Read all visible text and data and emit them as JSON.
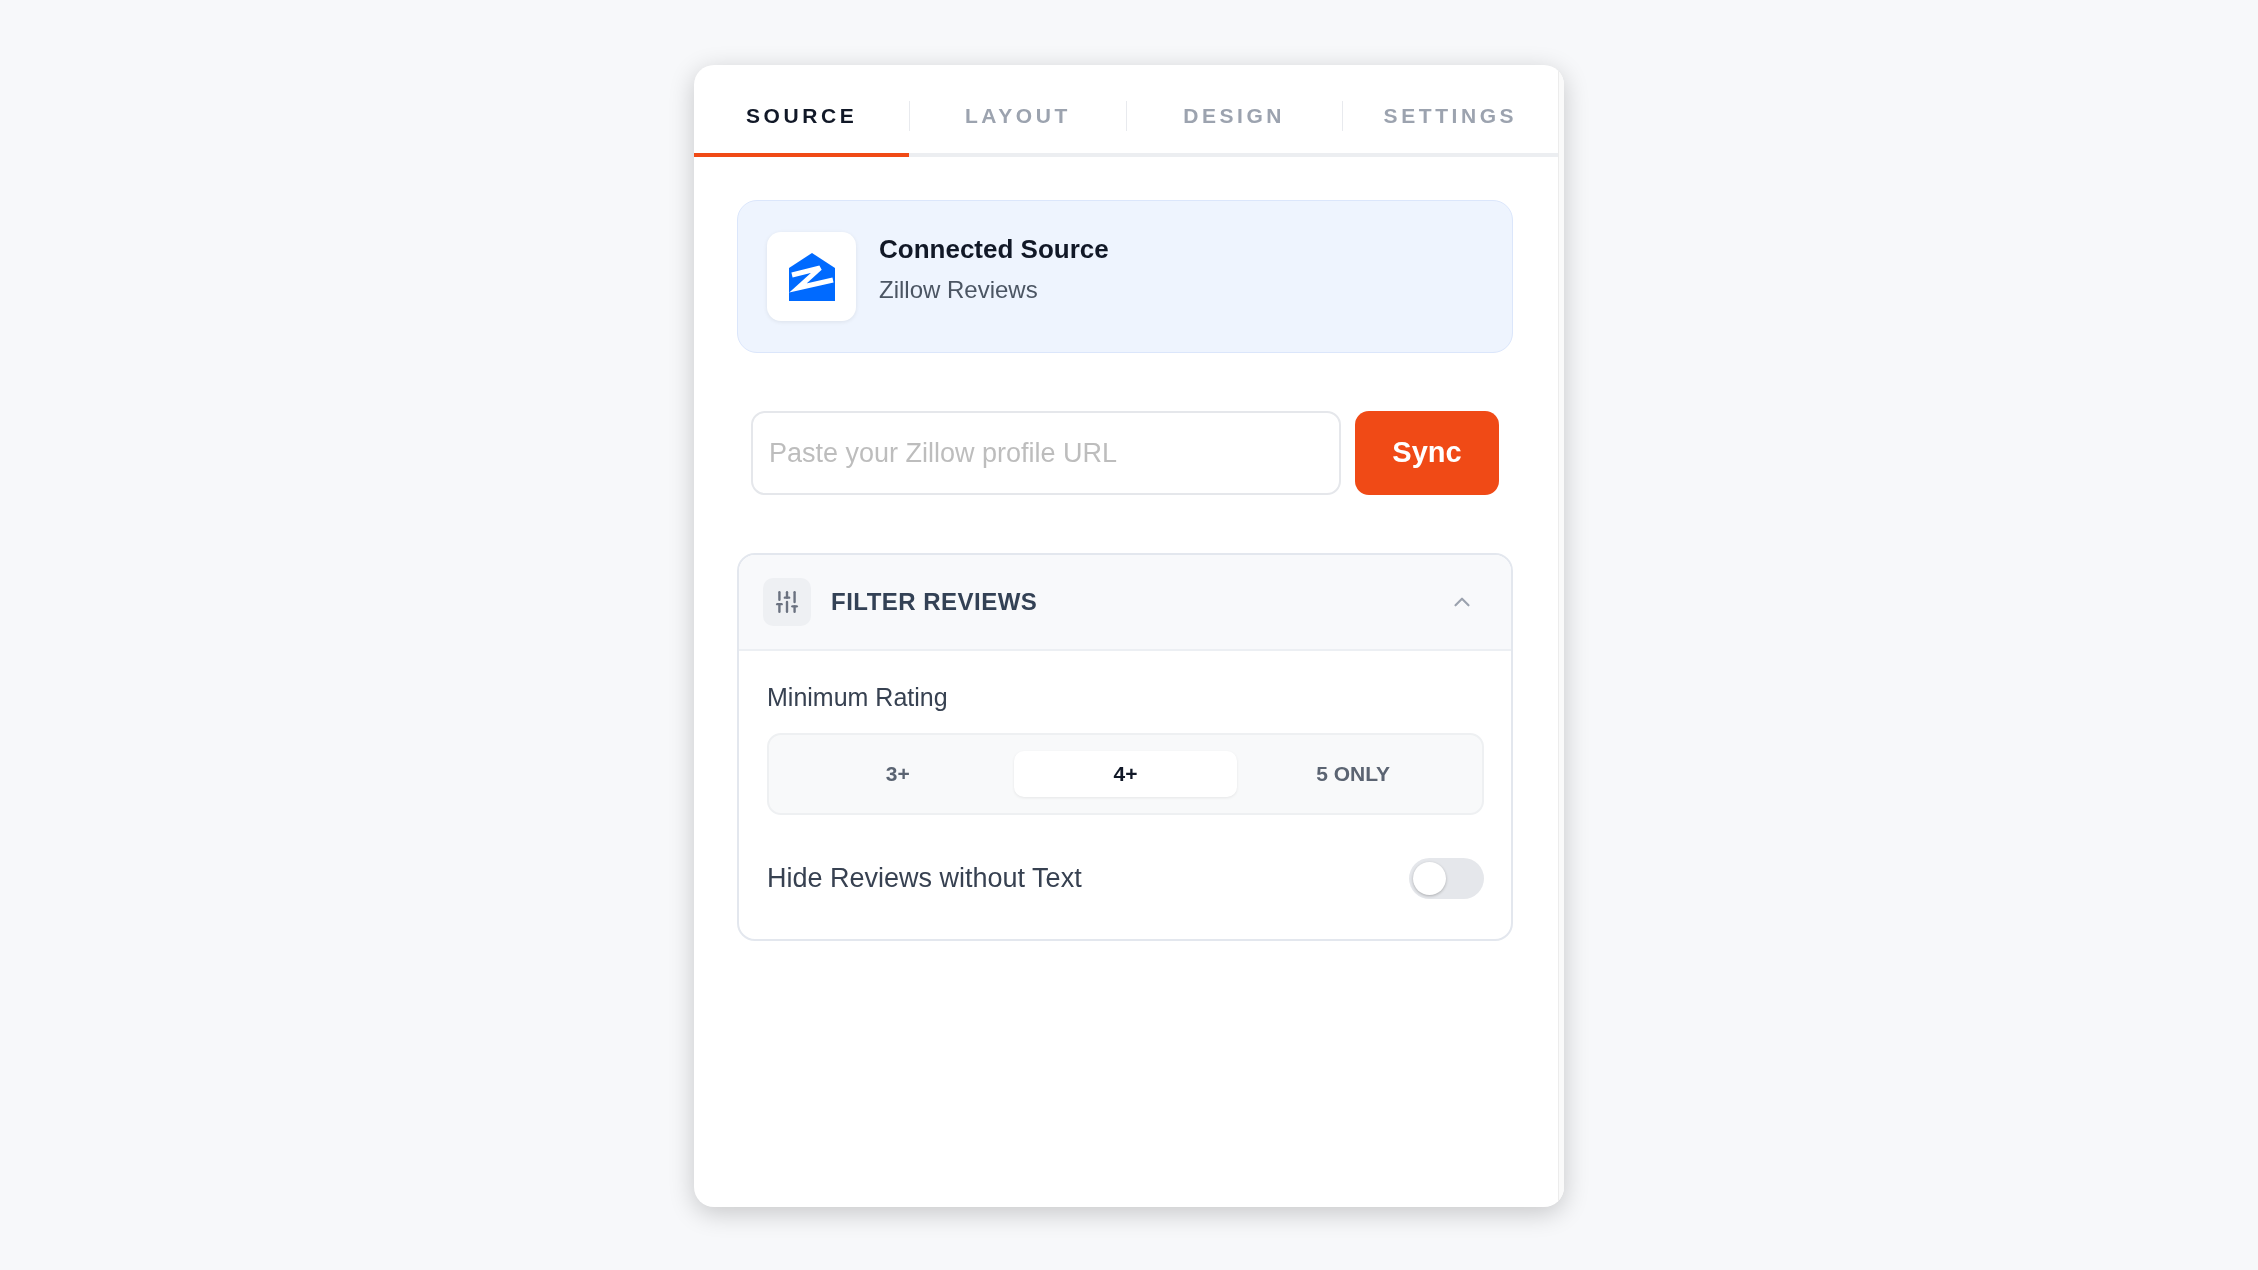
{
  "tabs": [
    {
      "label": "SOURCE",
      "selected": true
    },
    {
      "label": "LAYOUT",
      "selected": false
    },
    {
      "label": "DESIGN",
      "selected": false
    },
    {
      "label": "SETTINGS",
      "selected": false
    }
  ],
  "source_card": {
    "title": "Connected Source",
    "subtitle": "Zillow Reviews"
  },
  "url_field": {
    "placeholder": "Paste your Zillow profile URL"
  },
  "sync_button": {
    "label": "Sync"
  },
  "filter_section": {
    "title": "FILTER REVIEWS",
    "expanded": true,
    "minimum_rating": {
      "label": "Minimum Rating",
      "options": [
        {
          "label": "3+",
          "selected": false
        },
        {
          "label": "4+",
          "selected": true
        },
        {
          "label": "5 ONLY",
          "selected": false
        }
      ]
    },
    "hide_without_text": {
      "label": "Hide Reviews without Text",
      "on": false
    }
  }
}
